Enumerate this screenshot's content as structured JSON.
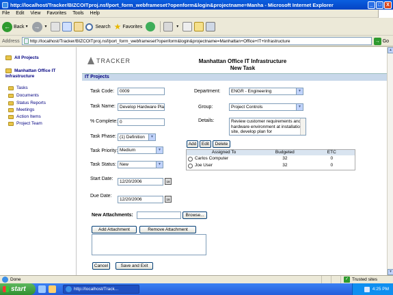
{
  "window": {
    "title": "http://localhost/Tracker/BIZCOITproj.nsf/port_form_webframeset?openform&login&projectname=Manha - Microsoft Internet Explorer",
    "minimize": "_",
    "maximize": "□",
    "close": "X"
  },
  "menu": [
    "File",
    "Edit",
    "View",
    "Favorites",
    "Tools",
    "Help"
  ],
  "toolbar": {
    "back": "Back",
    "search": "Search",
    "favorites": "Favorites"
  },
  "address": {
    "label": "Address",
    "url": "http://localhost/Tracker/BIZCOITproj.nsf/port_form_webframeset?openform&login&projectname=Manhattan+Office+IT+Infrastructure",
    "go": "Go"
  },
  "sidebar": {
    "all_projects": "All Projects",
    "project": "Manhattan Office IT Infrastructure",
    "items": [
      "Tasks",
      "Documents",
      "Status Reports",
      "Meetings",
      "Action Items",
      "Project Team"
    ]
  },
  "header": {
    "logo": "TRACKER",
    "title": "Manhattan Office IT Infrastructure",
    "subtitle": "New Task",
    "section": "IT Projects"
  },
  "form": {
    "task_code_label": "Task Code:",
    "task_code": "0009",
    "task_name_label": "Task Name:",
    "task_name": "Develop Hardware Plan",
    "complete_label": "% Complete:",
    "complete": "0",
    "phase_label": "Task Phase:",
    "phase": "(1) Definition",
    "priority_label": "Task Priority:",
    "priority": "Medium",
    "status_label": "Task Status:",
    "status": "New",
    "start_label": "Start Date:",
    "start_date": "12/20/2006",
    "due_label": "Due Date:",
    "due_date": "12/20/2006",
    "cal": "16",
    "department_label": "Department:",
    "department": "ENGR - Engineering",
    "group_label": "Group:",
    "group": "Project Controls",
    "details_label": "Details:",
    "details": "Review customer requirements and hardware environment at installation site, develop plan for",
    "add": "Add",
    "edit": "Edit",
    "delete": "Delete",
    "attachments_label": "New Attachments:",
    "browse": "Browse...",
    "add_attachment": "Add Attachment",
    "remove_attachment": "Remove Attachment",
    "cancel": "Cancel",
    "save_exit": "Save and Exit"
  },
  "assignments": {
    "headers": [
      "Assigned To",
      "Budgeted",
      "ETC"
    ],
    "rows": [
      {
        "name": "Carlos Computer",
        "budgeted": "32",
        "etc": "0"
      },
      {
        "name": "Joe User",
        "budgeted": "32",
        "etc": "0"
      }
    ]
  },
  "status": {
    "text": "Done",
    "zone": "Trusted sites"
  },
  "taskbar": {
    "start": "start",
    "task": "http://localhost/Track...",
    "clock": "4:25 PM"
  },
  "colors": {
    "titlebar": "#0a5fe0",
    "link": "#000080",
    "section_bg": "#c8d8ea"
  }
}
